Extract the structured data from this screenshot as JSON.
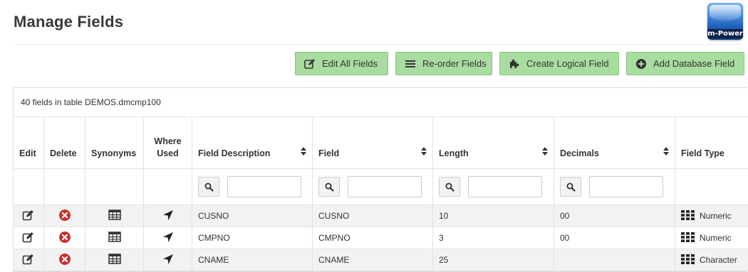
{
  "header": {
    "title": "Manage Fields",
    "logo_text": "m-Power"
  },
  "toolbar": {
    "edit_all": "Edit All Fields",
    "reorder": "Re-order Fields",
    "create_logical": "Create Logical Field",
    "add_database": "Add Database Field"
  },
  "panel": {
    "caption": "40 fields in table DEMOS.dmcmp100"
  },
  "table": {
    "headers": {
      "edit": "Edit",
      "delete": "Delete",
      "synonyms": "Synonyms",
      "where_used_1": "Where",
      "where_used_2": "Used",
      "field_description": "Field Description",
      "field": "Field",
      "length": "Length",
      "decimals": "Decimals",
      "field_type": "Field Type"
    },
    "rows": [
      {
        "description": "CUSNO",
        "field": "CUSNO",
        "length": "10",
        "decimals": "00",
        "type": "Numeric"
      },
      {
        "description": "CMPNO",
        "field": "CMPNO",
        "length": "3",
        "decimals": "00",
        "type": "Numeric"
      },
      {
        "description": "CNAME",
        "field": "CNAME",
        "length": "25",
        "decimals": "",
        "type": "Character"
      }
    ]
  },
  "colors": {
    "button_bg": "#a9dca0",
    "delete_red": "#c9302c",
    "row_stripe": "#f2f2f2"
  }
}
